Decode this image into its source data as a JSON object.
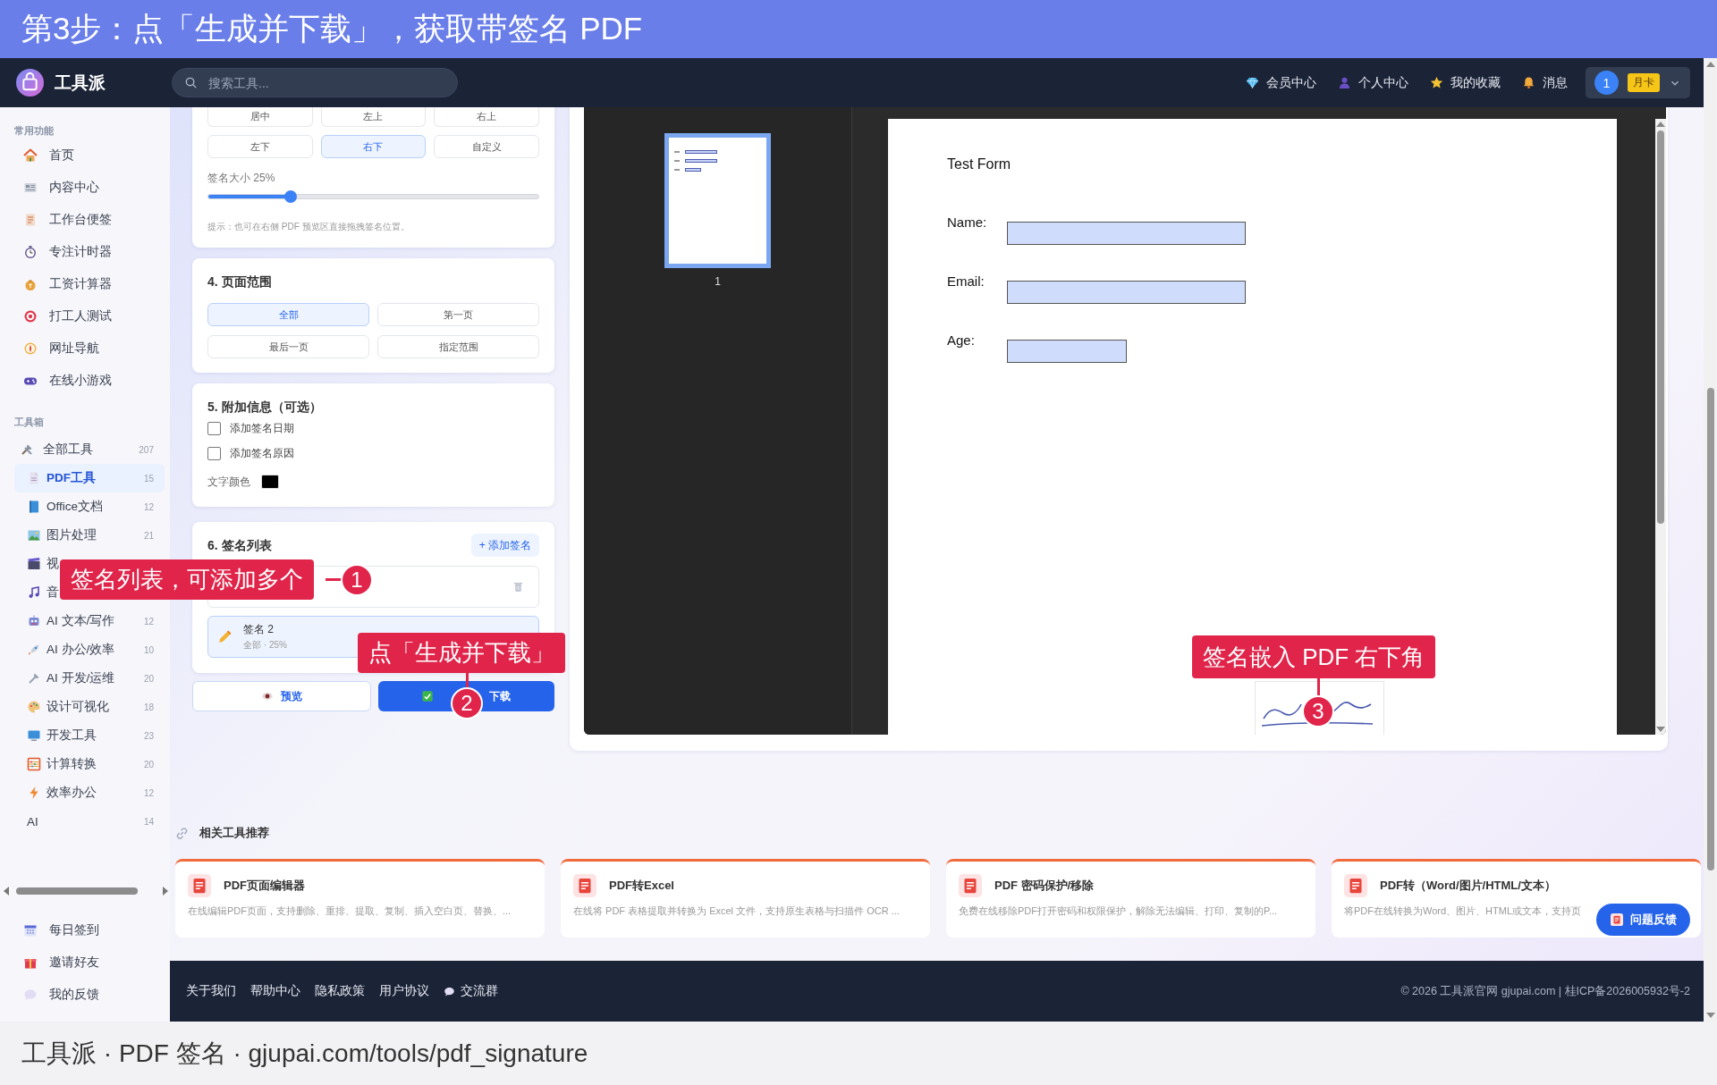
{
  "banner": {
    "title": "第3步：点「生成并下载」，获取带签名 PDF"
  },
  "header": {
    "brand": "工具派",
    "search": {
      "placeholder": "搜索工具..."
    },
    "nav": [
      {
        "label": "会员中心"
      },
      {
        "label": "个人中心"
      },
      {
        "label": "我的收藏"
      },
      {
        "label": "消息"
      }
    ],
    "user": {
      "avatar": "1",
      "badge": "月卡"
    }
  },
  "sidebar": {
    "common": {
      "title": "常用功能",
      "items": [
        {
          "label": "首页"
        },
        {
          "label": "内容中心"
        },
        {
          "label": "工作台便签"
        },
        {
          "label": "专注计时器"
        },
        {
          "label": "工资计算器"
        },
        {
          "label": "打工人测试"
        },
        {
          "label": "网址导航"
        },
        {
          "label": "在线小游戏"
        }
      ]
    },
    "toolbox": {
      "title": "工具箱",
      "items": [
        {
          "label": "全部工具",
          "count": "207",
          "selected": false,
          "children": [
            {
              "label": "PDF工具",
              "count": "15",
              "selected": true
            },
            {
              "label": "Office文档",
              "count": "12",
              "selected": false
            },
            {
              "label": "图片处理",
              "count": "21",
              "selected": false
            },
            {
              "label": "视",
              "selected": false
            },
            {
              "label": "音",
              "selected": false
            },
            {
              "label": "AI 文本/写作",
              "count": "12",
              "selected": false
            },
            {
              "label": "AI 办公/效率",
              "count": "10",
              "selected": false
            },
            {
              "label": "AI 开发/运维",
              "count": "20",
              "selected": false
            },
            {
              "label": "设计可视化",
              "count": "18",
              "selected": false
            },
            {
              "label": "开发工具",
              "count": "23",
              "selected": false
            },
            {
              "label": "计算转换",
              "count": "20",
              "selected": false
            },
            {
              "label": "效率办公",
              "count": "12",
              "selected": false
            },
            {
              "label": "AI",
              "count": "14",
              "selected": false
            }
          ]
        }
      ]
    },
    "bottom": [
      {
        "label": "每日签到"
      },
      {
        "label": "邀请好友"
      },
      {
        "label": "我的反馈"
      }
    ]
  },
  "panel": {
    "position": {
      "options": [
        {
          "label": "居中",
          "selected": false
        },
        {
          "label": "左上",
          "selected": false
        },
        {
          "label": "右上",
          "selected": false
        },
        {
          "label": "左下",
          "selected": false
        },
        {
          "label": "右下",
          "selected": true
        },
        {
          "label": "自定义",
          "selected": false
        }
      ]
    },
    "size": {
      "label": "签名大小 25%",
      "level": 0.25
    },
    "hint": "提示：也可在右侧 PDF 预览区直接拖拽签名位置。",
    "page_range": {
      "title": "4. 页面范围",
      "options": [
        {
          "label": "全部",
          "selected": true
        },
        {
          "label": "第一页",
          "selected": false
        },
        {
          "label": "最后一页",
          "selected": false
        },
        {
          "label": "指定范围",
          "selected": false
        }
      ]
    },
    "extra": {
      "title": "5. 附加信息（可选）",
      "checkboxes": [
        {
          "label": "添加签名日期",
          "checked": false
        },
        {
          "label": "添加签名原因",
          "checked": false
        }
      ],
      "color_label": "文字颜色",
      "color": "#000000"
    },
    "signatures": {
      "title": "6. 签名列表",
      "add_button": "+ 添加签名",
      "items": [
        {
          "selected": false,
          "trash": true
        },
        {
          "name": "签名 2",
          "meta": "全部 · 25%",
          "selected": true,
          "trash": false
        }
      ]
    },
    "actions": [
      {
        "label": "预览",
        "kind": "secondary"
      },
      {
        "label": "下载",
        "kind": "primary"
      }
    ]
  },
  "preview": {
    "thumbnails": [
      {
        "label": "1",
        "selected": true
      }
    ],
    "page": {
      "title": "Test Form",
      "fields": [
        {
          "label": "Name:",
          "kind": "long"
        },
        {
          "label": "Email:",
          "kind": "long"
        },
        {
          "label": "Age:",
          "kind": "short"
        }
      ]
    }
  },
  "related": {
    "title": "相关工具推荐",
    "cards": [
      {
        "title": "PDF页面编辑器",
        "description": "在线编辑PDF页面，支持删除、重排、提取、复制、插入空白页、替换、..."
      },
      {
        "title": "PDF转Excel",
        "description": "在线将 PDF 表格提取并转换为 Excel 文件，支持原生表格与扫描件 OCR ..."
      },
      {
        "title": "PDF 密码保护/移除",
        "description": "免费在线移除PDF打开密码和权限保护，解除无法编辑、打印、复制的P..."
      },
      {
        "title": "PDF转（Word/图片/HTML/文本）",
        "description": "将PDF在线转换为Word、图片、HTML或文本，支持页"
      }
    ]
  },
  "feedback": {
    "label": "问题反馈"
  },
  "footer": {
    "links": [
      {
        "label": "关于我们",
        "kind": "plain"
      },
      {
        "label": "帮助中心",
        "kind": "plain"
      },
      {
        "label": "隐私政策",
        "kind": "plain"
      },
      {
        "label": "用户协议",
        "kind": "plain"
      },
      {
        "label": "交流群",
        "kind": "chat"
      }
    ],
    "copyright": "© 2026 工具派官网 gjupai.com | 桂ICP备2026005932号-2"
  },
  "caption": "工具派 · PDF 签名 · gjupai.com/tools/pdf_signature",
  "callouts": [
    {
      "label": "签名列表，可添加多个",
      "number": "1"
    },
    {
      "label": "点「生成并下载」",
      "number": "2"
    },
    {
      "label": "签名嵌入 PDF 右下角",
      "number": "3"
    }
  ]
}
